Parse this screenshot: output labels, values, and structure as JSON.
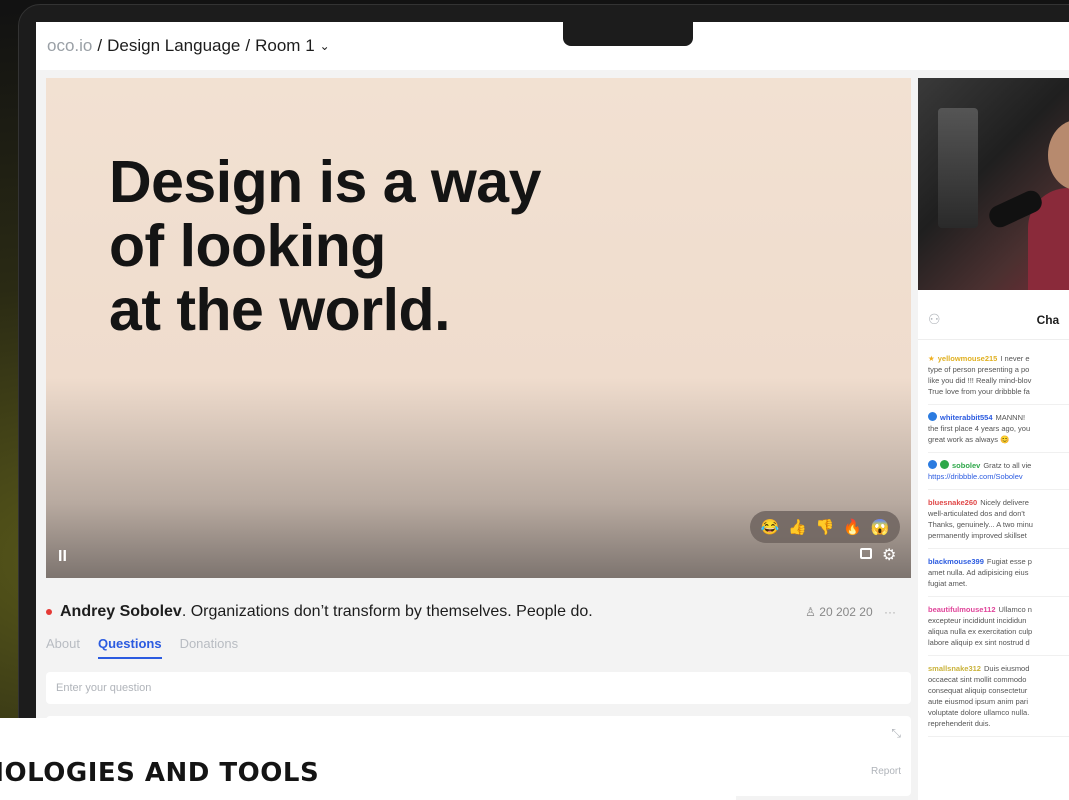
{
  "topbar": {
    "domain": "oco.io",
    "sep1": "/",
    "project": "Design Language",
    "sep2": "/",
    "room": "Room 1",
    "chevron": "⌄"
  },
  "video": {
    "headline": "Design is a way\nof looking\nat the world.",
    "reactions": [
      "😂",
      "👍",
      "👎",
      "🔥",
      "😱"
    ],
    "pause_icon": "II",
    "settings_icon": "⚙"
  },
  "stream": {
    "presenter": "Andrey Sobolev",
    "quote": ". Organizations don’t transform by themselves. People do.",
    "viewers": "20 202 20",
    "viewers_icon": "♙",
    "more_icon": "···"
  },
  "tabs": [
    {
      "label": "About"
    },
    {
      "label": "Questions"
    },
    {
      "label": "Donations"
    }
  ],
  "question_input": {
    "placeholder": "Enter your question"
  },
  "question_card": {
    "report_label": "Report",
    "expand_icon": "⤡"
  },
  "chat": {
    "title": "Cha",
    "users_icon": "⚇",
    "messages": [
      {
        "user": "yellowmouse215",
        "lines": [
          "I never e",
          "type of person presenting a po",
          "like you did !!! Really mind-blov",
          "True love from your dribbble fa"
        ]
      },
      {
        "user": "whiterabbit554",
        "lines": [
          "MANNN! ",
          "the first place 4 years ago, you",
          "great work as always 😊"
        ]
      },
      {
        "user": "sobolev",
        "lines": [
          "Gratz to all vie",
          "https://dribbble.com/Sobolev"
        ]
      },
      {
        "user": "bluesnake260",
        "lines": [
          "Nicely delivere",
          "well-articulated dos and don't",
          "Thanks, genuinely... A two minu",
          "permanently improved skillset"
        ]
      },
      {
        "user": "blackmouse399",
        "lines": [
          "Fugiat esse p",
          "amet nulla. Ad adipisicing eius",
          "fugiat amet."
        ]
      },
      {
        "user": "beautifulmouse112",
        "lines": [
          "Ullamco n",
          "excepteur incididunt incididun",
          "aliqua nulla ex exercitation culp",
          "labore aliquip ex sint nostrud d"
        ]
      },
      {
        "user": "smallsnake312",
        "lines": [
          "Duis eiusmod",
          "occaecat sint mollit commodo",
          "consequat aliquip consectetur",
          "aute eiusmod ipsum anim pari",
          "voluptate dolore ullamco nulla.",
          "reprehenderit duis."
        ]
      }
    ]
  },
  "overlay": {
    "text": "HNOLOGIES AND TOOLS"
  },
  "colors": {
    "accent": "#2b5be0",
    "live": "#e53935",
    "video_bg": "#f2e1d2"
  }
}
